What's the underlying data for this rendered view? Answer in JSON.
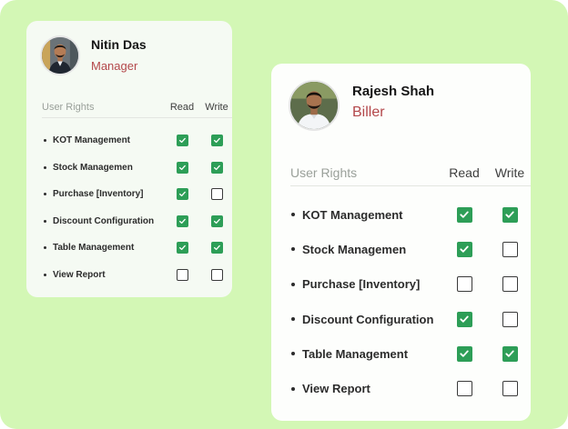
{
  "theme": {
    "background": "#d3f7b5",
    "accent_green": "#2d9e57",
    "role_red": "#b3474a"
  },
  "cards": [
    {
      "name": "Nitin Das",
      "role": "Manager",
      "header": {
        "rights": "User Rights",
        "read": "Read",
        "write": "Write"
      },
      "rows": [
        {
          "label": "KOT Management",
          "read": true,
          "write": true
        },
        {
          "label": "Stock Managemen",
          "read": true,
          "write": true
        },
        {
          "label": "Purchase [Inventory]",
          "read": true,
          "write": false
        },
        {
          "label": "Discount Configuration",
          "read": true,
          "write": true
        },
        {
          "label": "Table Management",
          "read": true,
          "write": true
        },
        {
          "label": "View Report",
          "read": false,
          "write": false
        }
      ]
    },
    {
      "name": "Rajesh Shah",
      "role": "Biller",
      "header": {
        "rights": "User Rights",
        "read": "Read",
        "write": "Write"
      },
      "rows": [
        {
          "label": "KOT Management",
          "read": true,
          "write": true
        },
        {
          "label": "Stock Managemen",
          "read": true,
          "write": false
        },
        {
          "label": "Purchase [Inventory]",
          "read": false,
          "write": false
        },
        {
          "label": "Discount Configuration",
          "read": true,
          "write": false
        },
        {
          "label": "Table Management",
          "read": true,
          "write": true
        },
        {
          "label": "View Report",
          "read": false,
          "write": false
        }
      ]
    }
  ]
}
